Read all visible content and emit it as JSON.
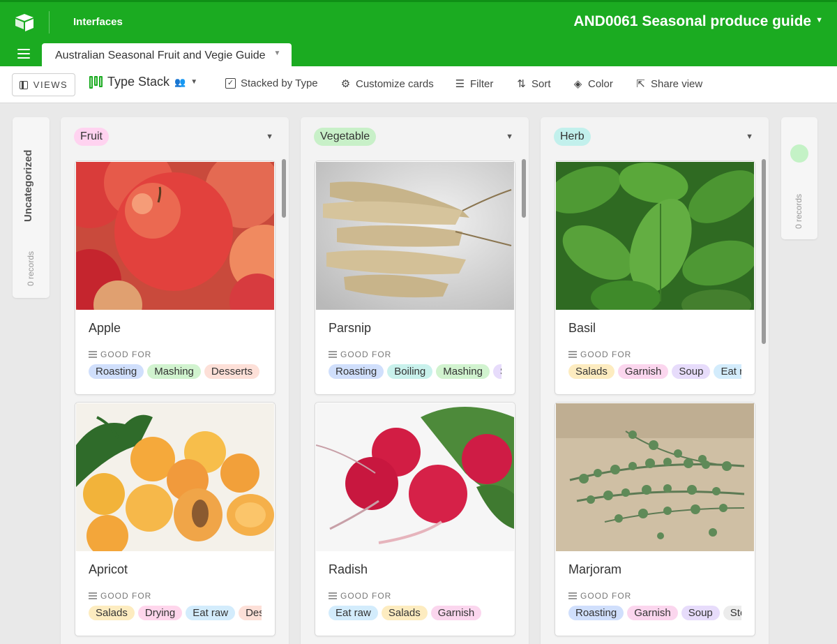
{
  "header": {
    "nav_link": "Interfaces",
    "base_title": "AND0061 Seasonal produce guide",
    "active_tab": "Australian Seasonal Fruit and Vegie Guide",
    "logo_icon": "airtable-logo-icon",
    "menu_icon": "hamburger-icon"
  },
  "toolbar": {
    "views_label": "VIEWS",
    "view_name": "Type Stack",
    "stacked_by": "Stacked by Type",
    "customize": "Customize cards",
    "filter": "Filter",
    "sort": "Sort",
    "color": "Color",
    "share": "Share view"
  },
  "board": {
    "uncategorized": {
      "label": "Uncategorized",
      "count": "0 records"
    },
    "empty_stack": {
      "count": "0 records",
      "color": "#c4f2c6"
    },
    "columns": [
      {
        "name": "Fruit",
        "color": "#ffd3f0",
        "cards": [
          {
            "title": "Apple",
            "field_label": "GOOD FOR",
            "tags": [
              "Roasting",
              "Mashing",
              "Desserts",
              ""
            ]
          },
          {
            "title": "Apricot",
            "field_label": "GOOD FOR",
            "tags": [
              "Salads",
              "Drying",
              "Eat raw",
              "Desserts"
            ]
          }
        ]
      },
      {
        "name": "Vegetable",
        "color": "#c8f0c8",
        "cards": [
          {
            "title": "Parsnip",
            "field_label": "GOOD FOR",
            "tags": [
              "Roasting",
              "Boiling",
              "Mashing",
              "Soup"
            ]
          },
          {
            "title": "Radish",
            "field_label": "GOOD FOR",
            "tags": [
              "Eat raw",
              "Salads",
              "Garnish"
            ]
          }
        ]
      },
      {
        "name": "Herb",
        "color": "#c2f0ec",
        "cards": [
          {
            "title": "Basil",
            "field_label": "GOOD FOR",
            "tags": [
              "Salads",
              "Garnish",
              "Soup",
              "Eat raw"
            ]
          },
          {
            "title": "Marjoram",
            "field_label": "GOOD FOR",
            "tags": [
              "Roasting",
              "Garnish",
              "Soup",
              "Stews"
            ]
          }
        ]
      }
    ],
    "tag_colors": {
      "Roasting": "#d0dffc",
      "Mashing": "#d1f3cf",
      "Desserts": "#fde0d8",
      "Salads": "#fdecc0",
      "Drying": "#ffd6ec",
      "Eat raw": "#d3ecfc",
      "Boiling": "#c9f1ec",
      "Soup": "#e7dcfb",
      "Garnish": "#fbd6ee",
      "Stews": "#ececec"
    }
  }
}
